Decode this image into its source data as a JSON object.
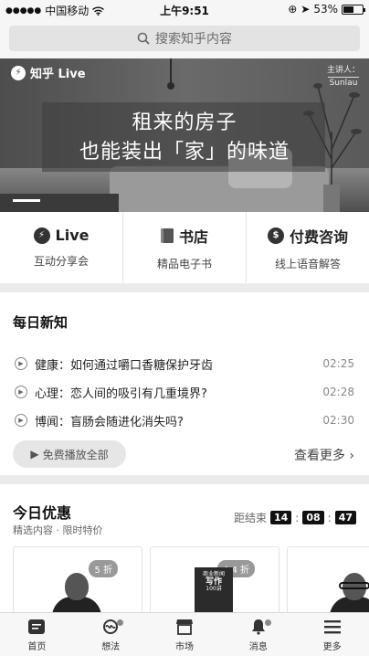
{
  "status": {
    "carrier": "中国移动",
    "time": "上午9:51",
    "battery": "53%",
    "battery_level": 0.53
  },
  "search": {
    "placeholder": "搜索知乎内容"
  },
  "banner": {
    "tag": "知乎 Live",
    "speaker_label": "主讲人：",
    "speaker_name": "Sunlau",
    "line1": "租来的房子",
    "line2": "也能装出「家」的味道"
  },
  "categories": [
    {
      "title": "Live",
      "sub": "互动分享会",
      "icon": "bolt-icon"
    },
    {
      "title": "书店",
      "sub": "精品电子书",
      "icon": "book-icon"
    },
    {
      "title": "付费咨询",
      "sub": "线上语音解答",
      "icon": "chat-icon"
    }
  ],
  "daily": {
    "title": "每日新知",
    "items": [
      {
        "text": "健康：如何通过嚼口香糖保护牙齿",
        "time": "02:25"
      },
      {
        "text": "心理：恋人间的吸引有几重境界?",
        "time": "02:28"
      },
      {
        "text": "博闻：盲肠会随进化消失吗?",
        "time": "02:30"
      }
    ],
    "play_all": "免费播放全部",
    "see_more": "查看更多 ›"
  },
  "deals": {
    "title": "今日优惠",
    "subtitle": "精选内容 · 限时特价",
    "countdown_label": "距结束",
    "hh": "14",
    "mm": "08",
    "ss": "47",
    "cards": [
      {
        "discount": "5 折"
      },
      {
        "discount": "4.4 折",
        "book_line1": "商业新闻",
        "book_line2": "写作",
        "book_line3": "100讲"
      },
      {
        "discount": ""
      }
    ]
  },
  "tabs": [
    {
      "label": "首页"
    },
    {
      "label": "想法"
    },
    {
      "label": "市场"
    },
    {
      "label": "消息"
    },
    {
      "label": "更多"
    }
  ]
}
